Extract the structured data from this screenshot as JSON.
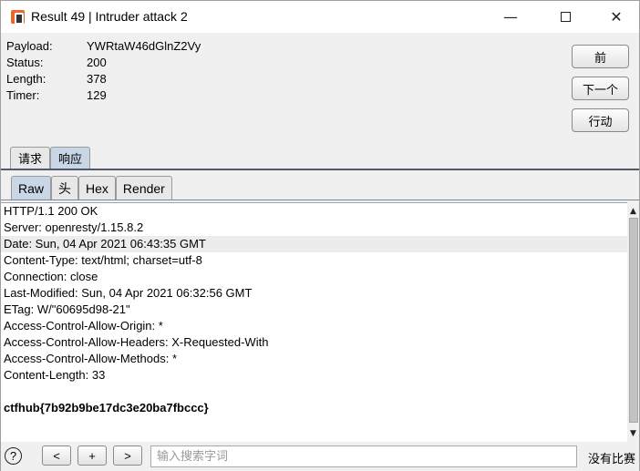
{
  "window": {
    "title": "Result 49 | Intruder attack 2",
    "minimize_glyph": "—",
    "close_glyph": "✕"
  },
  "info": [
    {
      "key": "Payload:",
      "value": "YWRtaW46dGlnZ2Vy"
    },
    {
      "key": "Status:",
      "value": "200"
    },
    {
      "key": "Length:",
      "value": "378"
    },
    {
      "key": "Timer:",
      "value": "129"
    }
  ],
  "side_buttons": {
    "prev": "前",
    "next": "下一个",
    "action": "行动"
  },
  "outer_tabs": [
    {
      "label": "请求",
      "active": false
    },
    {
      "label": "响应",
      "active": true
    }
  ],
  "inner_tabs": [
    {
      "label": "Raw",
      "active": true
    },
    {
      "label": "头",
      "active": false
    },
    {
      "label": "Hex",
      "active": false
    },
    {
      "label": "Render",
      "active": false
    }
  ],
  "response_lines": [
    "HTTP/1.1 200 OK",
    "Server: openresty/1.15.8.2",
    "Date: Sun, 04 Apr 2021 06:43:35 GMT",
    "Content-Type: text/html; charset=utf-8",
    "Connection: close",
    "Last-Modified: Sun, 04 Apr 2021 06:32:56 GMT",
    "ETag: W/\"60695d98-21\"",
    "Access-Control-Allow-Origin: *",
    "Access-Control-Allow-Headers: X-Requested-With",
    "Access-Control-Allow-Methods: *",
    "Content-Length: 33",
    "",
    "ctfhub{7b92b9be17dc3e20ba7fbccc}"
  ],
  "highlighted_line_index": 2,
  "bold_line_index": 12,
  "bottom": {
    "help": "?",
    "prev": "<",
    "add": "+",
    "next": ">",
    "search_placeholder": "输入搜索字词",
    "match_status": "没有比赛"
  },
  "colors": {
    "active_tab": "#c9d6e6",
    "tab_underline": "#505a6b",
    "app_icon": "#e8682a"
  }
}
